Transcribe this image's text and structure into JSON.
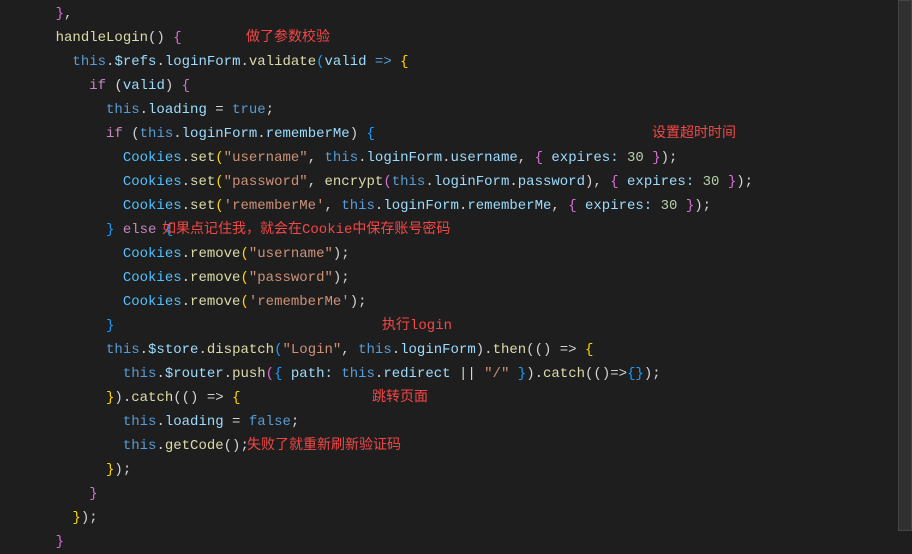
{
  "annotations": {
    "a1": "做了参数校验",
    "a2": "设置超时时间",
    "a3": "如果点记住我，就会在Cookie中保存账号密码",
    "a4": "执行login",
    "a5": "跳转页面",
    "a6": "失败了就重新刷新验证码"
  },
  "code": {
    "l0a": "    ",
    "l0b": "}",
    "l0c": ",",
    "l1a": "    ",
    "l1b": "handleLogin",
    "l1c": "() ",
    "l1d": "{",
    "l2a": "      ",
    "l2b": "this",
    "l2c": ".",
    "l2d": "$refs",
    "l2e": ".",
    "l2f": "loginForm",
    "l2g": ".",
    "l2h": "validate",
    "l2i": "(",
    "l2j": "valid",
    "l2k": " => ",
    "l2l": "{",
    "l3a": "        ",
    "l3b": "if",
    "l3c": " (",
    "l3d": "valid",
    "l3e": ") ",
    "l3f": "{",
    "l4a": "          ",
    "l4b": "this",
    "l4c": ".",
    "l4d": "loading",
    "l4e": " = ",
    "l4f": "true",
    "l4g": ";",
    "l5a": "          ",
    "l5b": "if",
    "l5c": " (",
    "l5d": "this",
    "l5e": ".",
    "l5f": "loginForm",
    "l5g": ".",
    "l5h": "rememberMe",
    "l5i": ") ",
    "l5j": "{",
    "l6a": "            ",
    "l6b": "Cookies",
    "l6c": ".",
    "l6d": "set",
    "l6e": "(",
    "l6f": "\"username\"",
    "l6g": ", ",
    "l6h": "this",
    "l6i": ".",
    "l6j": "loginForm",
    "l6k": ".",
    "l6l": "username",
    "l6m": ", ",
    "l6n": "{",
    "l6o": " ",
    "l6p": "expires:",
    "l6q": " ",
    "l6r": "30",
    "l6s": " ",
    "l6t": "}",
    "l6u": ");",
    "l7a": "            ",
    "l7b": "Cookies",
    "l7c": ".",
    "l7d": "set",
    "l7e": "(",
    "l7f": "\"password\"",
    "l7g": ", ",
    "l7h": "encrypt",
    "l7i": "(",
    "l7j": "this",
    "l7k": ".",
    "l7l": "loginForm",
    "l7m": ".",
    "l7n": "password",
    "l7o": "), ",
    "l7p": "{",
    "l7q": " ",
    "l7r": "expires:",
    "l7s": " ",
    "l7t": "30",
    "l7u": " ",
    "l7v": "}",
    "l7w": ");",
    "l8a": "            ",
    "l8b": "Cookies",
    "l8c": ".",
    "l8d": "set",
    "l8e": "(",
    "l8f": "'rememberMe'",
    "l8g": ", ",
    "l8h": "this",
    "l8i": ".",
    "l8j": "loginForm",
    "l8k": ".",
    "l8l": "rememberMe",
    "l8m": ", ",
    "l8n": "{",
    "l8o": " ",
    "l8p": "expires:",
    "l8q": " ",
    "l8r": "30",
    "l8s": " ",
    "l8t": "}",
    "l8u": ");",
    "l9a": "          ",
    "l9b": "}",
    "l9c": " ",
    "l9d": "else",
    "l9e": " ",
    "l9f": "{",
    "l10a": "            ",
    "l10b": "Cookies",
    "l10c": ".",
    "l10d": "remove",
    "l10e": "(",
    "l10f": "\"username\"",
    "l10g": ");",
    "l11a": "            ",
    "l11b": "Cookies",
    "l11c": ".",
    "l11d": "remove",
    "l11e": "(",
    "l11f": "\"password\"",
    "l11g": ");",
    "l12a": "            ",
    "l12b": "Cookies",
    "l12c": ".",
    "l12d": "remove",
    "l12e": "(",
    "l12f": "'rememberMe'",
    "l12g": ");",
    "l13a": "          ",
    "l13b": "}",
    "l14a": "          ",
    "l14b": "this",
    "l14c": ".",
    "l14d": "$store",
    "l14e": ".",
    "l14f": "dispatch",
    "l14g": "(",
    "l14h": "\"Login\"",
    "l14i": ", ",
    "l14j": "this",
    "l14k": ".",
    "l14l": "loginForm",
    "l14m": ").",
    "l14n": "then",
    "l14o": "(() => ",
    "l14p": "{",
    "l15a": "            ",
    "l15b": "this",
    "l15c": ".",
    "l15d": "$router",
    "l15e": ".",
    "l15f": "push",
    "l15g": "(",
    "l15h": "{",
    "l15i": " ",
    "l15j": "path:",
    "l15k": " ",
    "l15l": "this",
    "l15m": ".",
    "l15n": "redirect",
    "l15o": " || ",
    "l15p": "\"/\"",
    "l15q": " ",
    "l15r": "}",
    "l15s": ").",
    "l15t": "catch",
    "l15u": "(()=>",
    "l15v": "{}",
    "l15w": ");",
    "l16a": "          ",
    "l16b": "}",
    "l16c": ").",
    "l16d": "catch",
    "l16e": "(() => ",
    "l16f": "{",
    "l17a": "            ",
    "l17b": "this",
    "l17c": ".",
    "l17d": "loading",
    "l17e": " = ",
    "l17f": "false",
    "l17g": ";",
    "l18a": "            ",
    "l18b": "this",
    "l18c": ".",
    "l18d": "getCode",
    "l18e": "();",
    "l19a": "          ",
    "l19b": "}",
    "l19c": ");",
    "l20a": "        ",
    "l20b": "}",
    "l21a": "      ",
    "l21b": "}",
    "l21c": ");",
    "l22a": "    ",
    "l22b": "}"
  }
}
